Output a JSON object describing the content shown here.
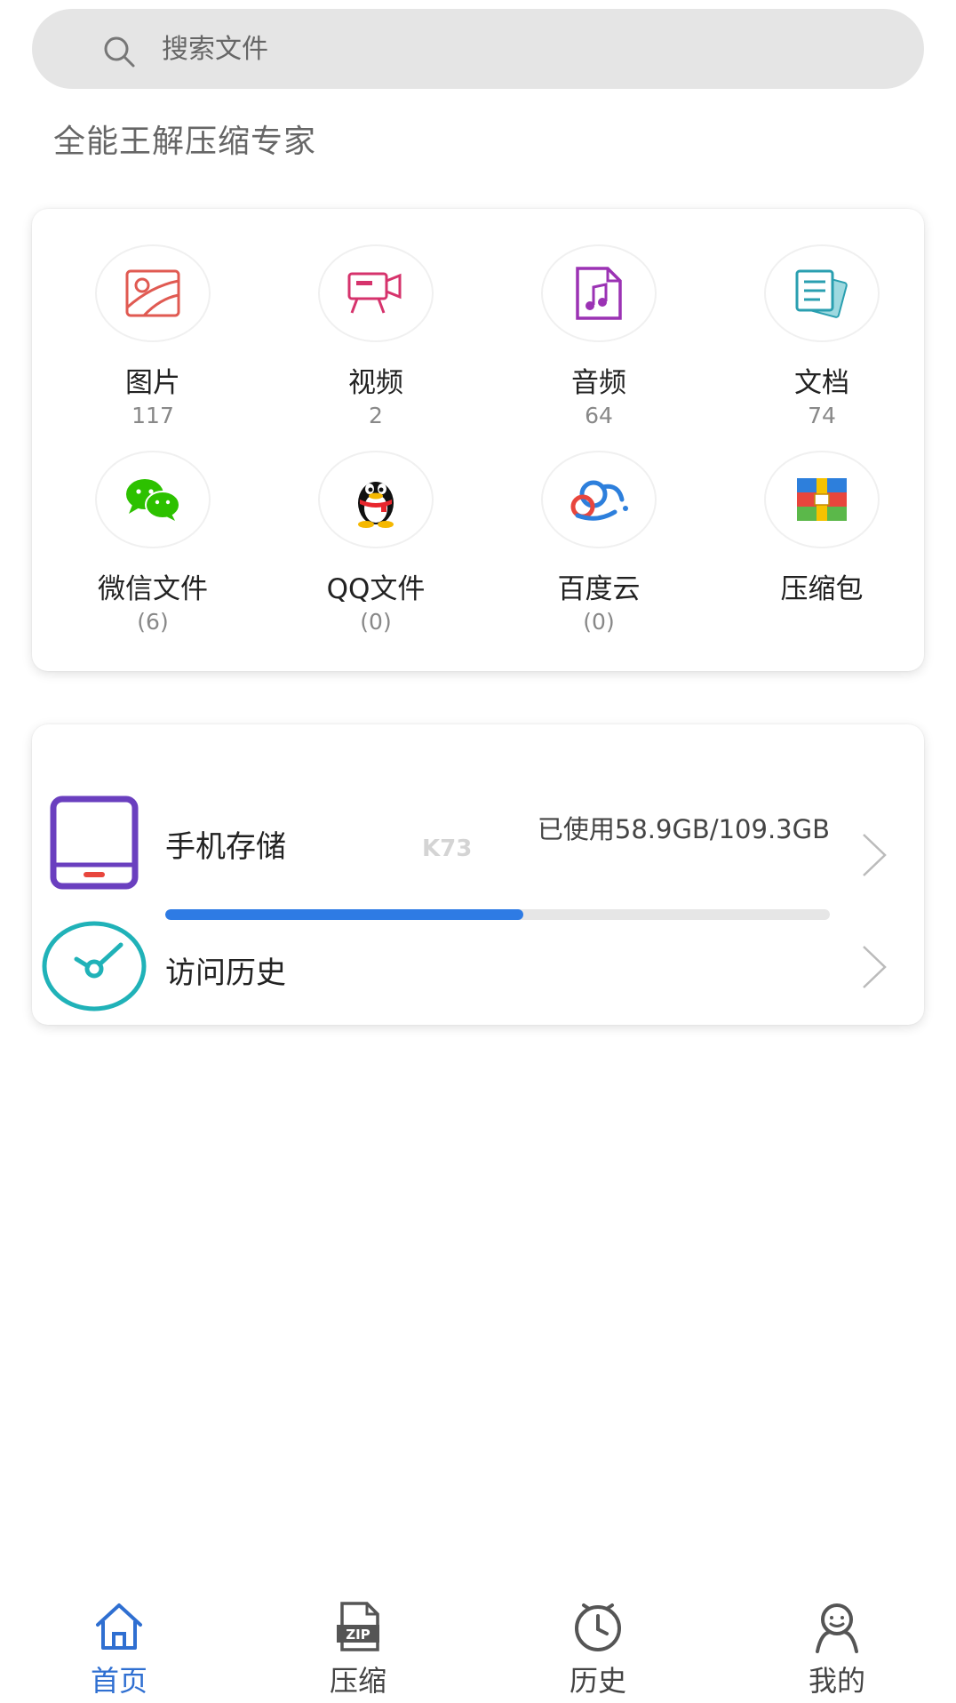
{
  "search": {
    "placeholder": "搜索文件"
  },
  "subtitle": "全能王解压缩专家",
  "categories": [
    {
      "label": "图片",
      "count": "117",
      "icon": "image-icon",
      "color": "#e05a52"
    },
    {
      "label": "视频",
      "count": "2",
      "icon": "video-camera-icon",
      "color": "#d6336c"
    },
    {
      "label": "音频",
      "count": "64",
      "icon": "music-file-icon",
      "color": "#9b32b4"
    },
    {
      "label": "文档",
      "count": "74",
      "icon": "document-icon",
      "color": "#2a9fb0"
    },
    {
      "label": "微信文件",
      "count": "(6)",
      "icon": "wechat-icon",
      "color": "#2dc100"
    },
    {
      "label": "QQ文件",
      "count": "(0)",
      "icon": "qq-penguin-icon",
      "color": "#111111"
    },
    {
      "label": "百度云",
      "count": "(0)",
      "icon": "baidu-cloud-icon",
      "color": "#2d7fdc"
    },
    {
      "label": "压缩包",
      "count": "",
      "icon": "archive-icon",
      "color": "#e8463d"
    }
  ],
  "storage": {
    "title": "手机存储",
    "used_text": "已使用58.9GB/109.3GB",
    "used_fraction": 0.539,
    "accent": "#2e7be4",
    "icon": "phone-storage-icon"
  },
  "history": {
    "title": "访问历史",
    "icon": "clock-icon"
  },
  "watermark": "K73",
  "nav": [
    {
      "label": "首页",
      "icon": "home-icon",
      "active": true
    },
    {
      "label": "压缩",
      "icon": "zip-icon",
      "active": false
    },
    {
      "label": "历史",
      "icon": "history-clock-icon",
      "active": false
    },
    {
      "label": "我的",
      "icon": "profile-icon",
      "active": false
    }
  ],
  "colors": {
    "active_nav": "#2f6fd1",
    "search_bg": "#e5e5e5"
  }
}
